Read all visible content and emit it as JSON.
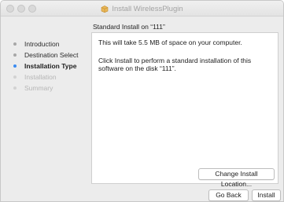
{
  "window": {
    "title": "Install WirelessPlugin"
  },
  "icons": {
    "window_icon": "package-icon"
  },
  "colors": {
    "current_step": "#3b8cf2"
  },
  "sidebar": {
    "steps": [
      {
        "label": "Introduction",
        "state": "done"
      },
      {
        "label": "Destination Select",
        "state": "done"
      },
      {
        "label": "Installation Type",
        "state": "current"
      },
      {
        "label": "Installation",
        "state": "todo"
      },
      {
        "label": "Summary",
        "state": "todo"
      }
    ]
  },
  "main": {
    "heading": "Standard Install on “111”",
    "space_text": "This will take 5.5 MB of space on your computer.",
    "install_text": "Click Install to perform a standard installation of this software on the disk “111”.",
    "change_location_label": "Change Install Location..."
  },
  "footer": {
    "back_label": "Go Back",
    "install_label": "Install"
  }
}
